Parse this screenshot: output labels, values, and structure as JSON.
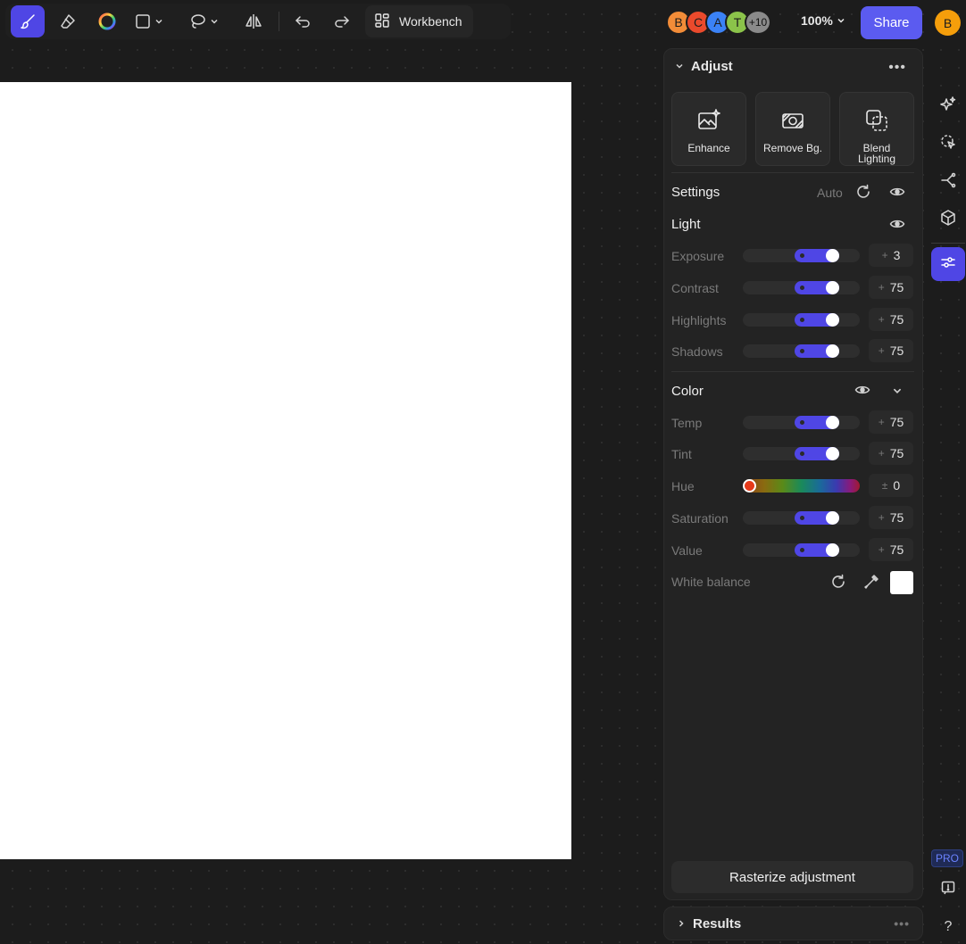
{
  "toolbar": {
    "tools": [
      "brush-icon",
      "eraser-icon",
      "color-wheel-icon",
      "rectangle-icon",
      "lasso-icon",
      "flip-icon",
      "undo-icon",
      "redo-icon"
    ],
    "workbench_label": "Workbench"
  },
  "collaborators": {
    "avatars": [
      {
        "initial": "B",
        "color": "#f28c38"
      },
      {
        "initial": "C",
        "color": "#ea4a2c"
      },
      {
        "initial": "A",
        "color": "#3b82f6"
      },
      {
        "initial": "T",
        "color": "#8bc34a"
      }
    ],
    "overflow": "+10"
  },
  "zoom": "100%",
  "share_label": "Share",
  "user_initial": "B",
  "adjust_panel": {
    "title": "Adjust",
    "actions": [
      {
        "label": "Enhance",
        "icon": "enhance-icon"
      },
      {
        "label": "Remove Bg.",
        "icon": "remove-bg-icon"
      },
      {
        "label": "Blend Lighting",
        "icon": "blend-lighting-icon"
      }
    ],
    "settings": {
      "title": "Settings",
      "auto_label": "Auto"
    },
    "light": {
      "title": "Light",
      "rows": [
        {
          "label": "Exposure",
          "value": "3",
          "sign": "+",
          "level": 0.8
        },
        {
          "label": "Contrast",
          "value": "75",
          "sign": "+",
          "level": 0.8
        },
        {
          "label": "Highlights",
          "value": "75",
          "sign": "+",
          "level": 0.8
        },
        {
          "label": "Shadows",
          "value": "75",
          "sign": "+",
          "level": 0.8
        }
      ]
    },
    "color": {
      "title": "Color",
      "rows": [
        {
          "label": "Temp",
          "value": "75",
          "sign": "+",
          "level": 0.8
        },
        {
          "label": "Tint",
          "value": "75",
          "sign": "+",
          "level": 0.8
        },
        {
          "label": "Hue",
          "value": "0",
          "sign": "±",
          "level": 0
        },
        {
          "label": "Saturation",
          "value": "75",
          "sign": "+",
          "level": 0.8
        },
        {
          "label": "Value",
          "value": "75",
          "sign": "+",
          "level": 0.8
        }
      ],
      "white_balance_label": "White balance",
      "white_balance_color": "#ffffff"
    },
    "rasterize_label": "Rasterize adjustment"
  },
  "results_panel": {
    "title": "Results"
  },
  "pro_badge": "PRO",
  "colors": {
    "accent": "#4f46e5",
    "share": "#5b5bf0",
    "background": "#1c1c1c",
    "panel": "#232323"
  }
}
